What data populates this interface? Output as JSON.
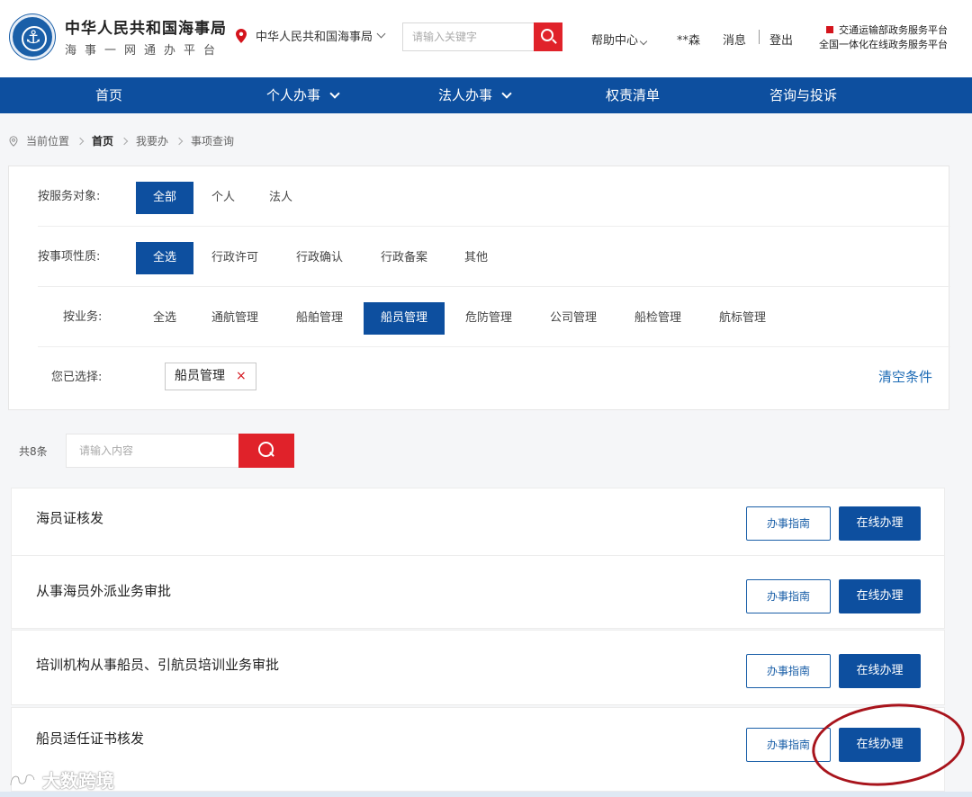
{
  "header": {
    "org_title": "中华人民共和国海事局",
    "org_subtitle": "海事一网通办平台",
    "location": "中华人民共和国海事局",
    "search_placeholder": "请输入关键字",
    "help": "帮助中心",
    "user": "**森",
    "messages": "消息",
    "logout": "登出",
    "platform_line1": "交通运输部政务服务平台",
    "platform_line2": "全国一体化在线政务服务平台"
  },
  "nav": [
    {
      "label": "首页",
      "dropdown": false
    },
    {
      "label": "个人办事",
      "dropdown": true
    },
    {
      "label": "法人办事",
      "dropdown": true
    },
    {
      "label": "权责清单",
      "dropdown": false
    },
    {
      "label": "咨询与投诉",
      "dropdown": false
    }
  ],
  "breadcrumb": {
    "prefix": "当前位置",
    "items": [
      "首页",
      "我要办",
      "事项查询"
    ]
  },
  "filters": {
    "service_target": {
      "label": "按服务对象:",
      "options": [
        "全部",
        "个人",
        "法人"
      ],
      "selected": "全部"
    },
    "item_nature": {
      "label": "按事项性质:",
      "options": [
        "全选",
        "行政许可",
        "行政确认",
        "行政备案",
        "其他"
      ],
      "selected": "全选"
    },
    "business": {
      "label": "按业务:",
      "options": [
        "全选",
        "通航管理",
        "船舶管理",
        "船员管理",
        "危防管理",
        "公司管理",
        "船检管理",
        "航标管理"
      ],
      "selected": "船员管理"
    },
    "chosen": {
      "label": "您已选择:",
      "chip": "船员管理",
      "remove": "×",
      "clear": "清空条件"
    }
  },
  "list": {
    "count": "共8条",
    "search_placeholder": "请输入内容",
    "guide_label": "办事指南",
    "online_label": "在线办理",
    "items": [
      {
        "title": "海员证核发"
      },
      {
        "title": "从事海员外派业务审批"
      },
      {
        "title": "培训机构从事船员、引航员培训业务审批"
      },
      {
        "title": "船员适任证书核发"
      }
    ]
  },
  "watermark": "大数跨境",
  "colors": {
    "primary": "#0d4f9f",
    "accent_red": "#e0222a",
    "link": "#1d6bb5"
  }
}
